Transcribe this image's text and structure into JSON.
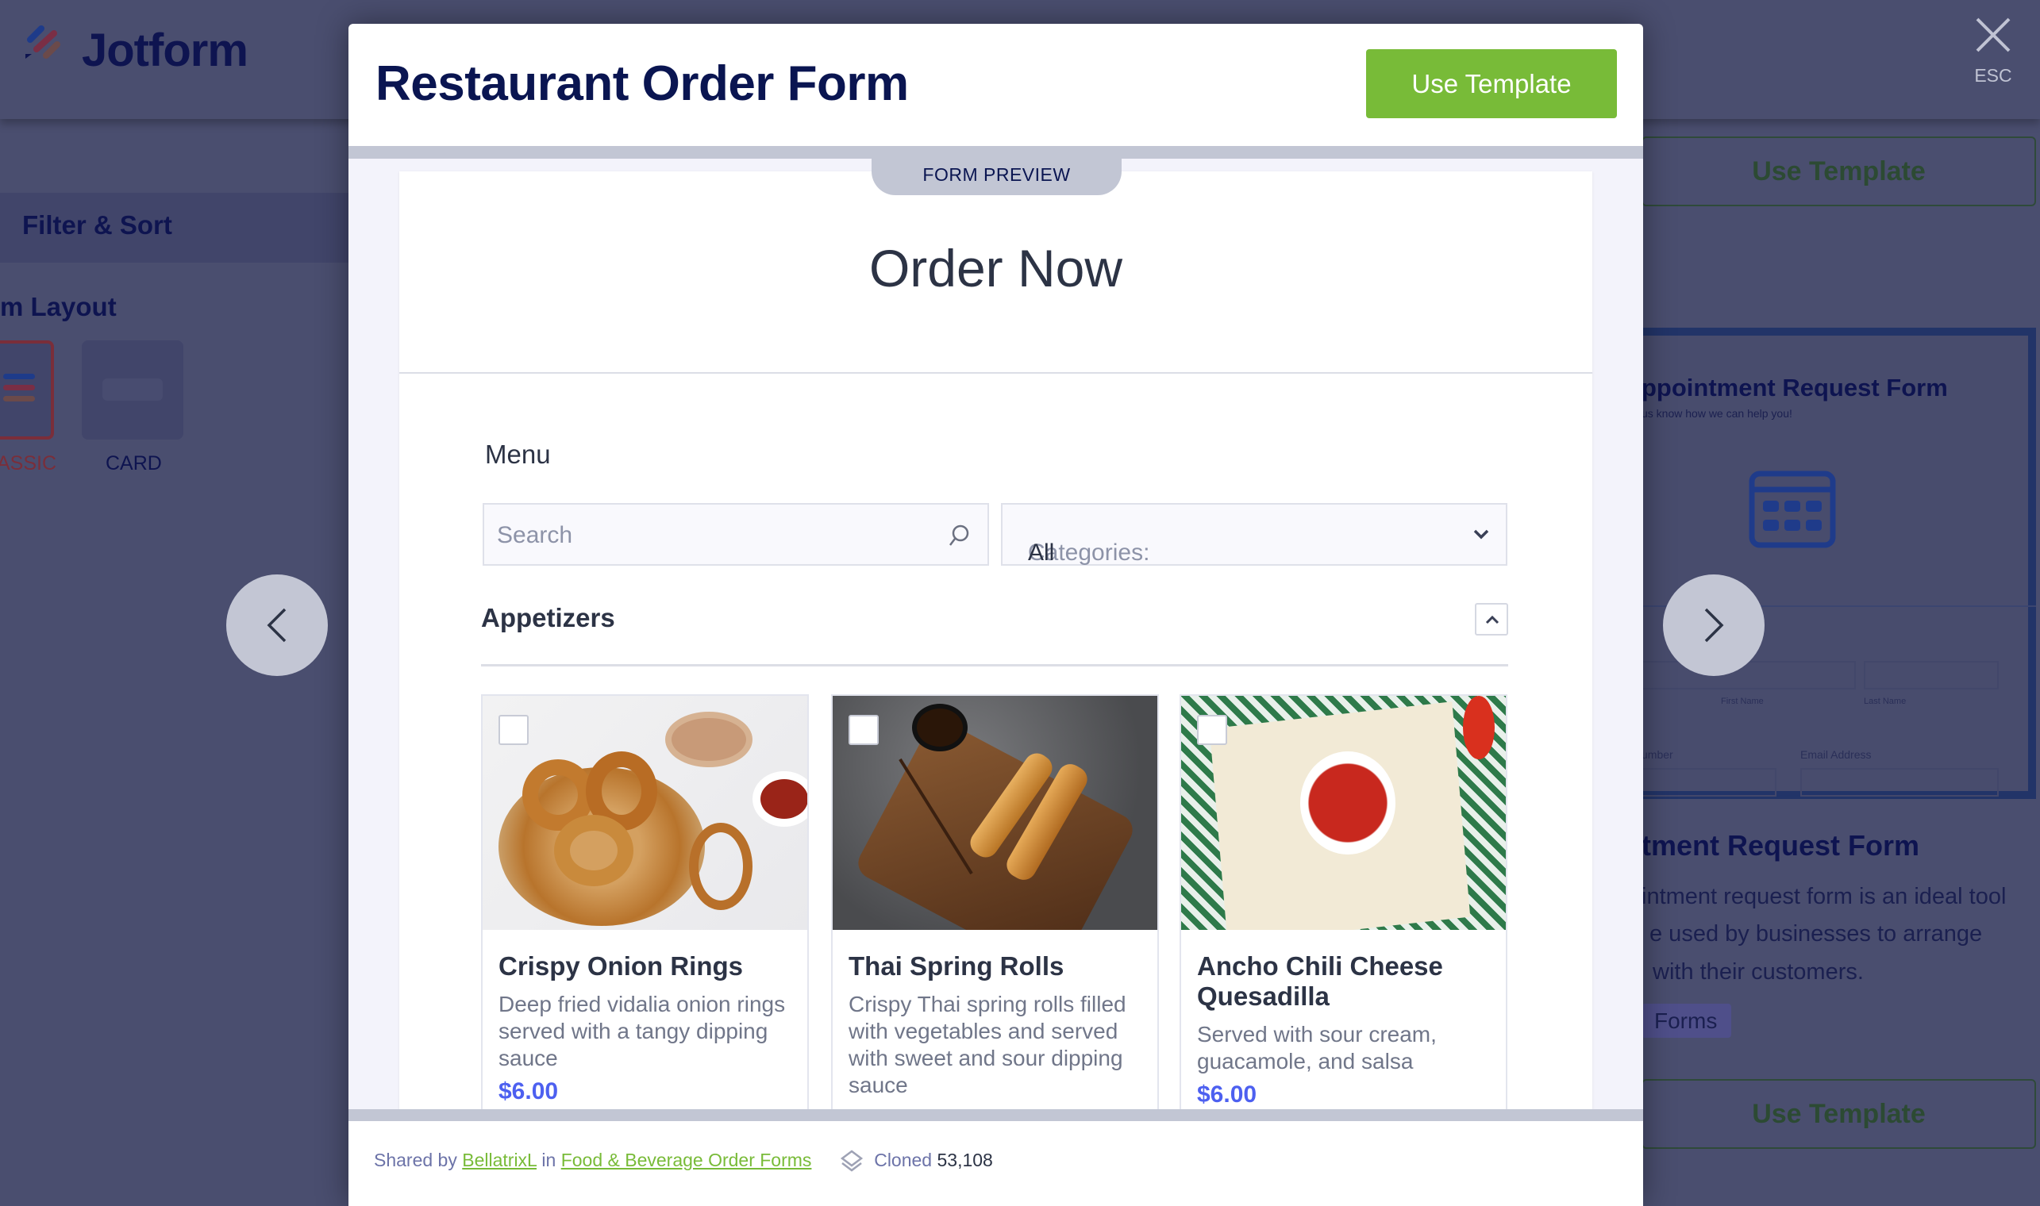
{
  "background": {
    "logo": "Jotform",
    "filter_sort": "Filter & Sort",
    "layout_heading": "m Layout",
    "layouts": [
      {
        "label": "ASSIC",
        "selected": true
      },
      {
        "label": "CARD",
        "selected": false
      }
    ],
    "use_template": "Use Template",
    "next_card": {
      "preview_title": "ppointment Request Form",
      "preview_subtitle": "us know how we can help you!",
      "field_labels": [
        "First Name",
        "Last Name",
        "umber",
        "Email Address"
      ],
      "title": "tment Request Form",
      "description_lines": [
        "intment request form is an ideal tool",
        "e used by businesses to arrange",
        "with their customers."
      ],
      "category_badge": "Forms"
    },
    "close_label": "ESC"
  },
  "modal": {
    "title": "Restaurant Order Form",
    "use_template": "Use Template",
    "preview_tab": "FORM PREVIEW",
    "accent_color": "#78bb38",
    "form": {
      "heading": "Order Now",
      "menu_label": "Menu",
      "search_placeholder": "Search",
      "categories_label": "Categories:",
      "categories_value": "All",
      "section": "Appetizers",
      "items": [
        {
          "title": "Crispy Onion Rings",
          "description": "Deep fried vidalia onion rings served with a tangy dipping sauce",
          "price": "$6.00",
          "checked": false
        },
        {
          "title": "Thai Spring Rolls",
          "description": "Crispy Thai spring rolls filled with vegetables and served with sweet and sour dipping sauce",
          "price": "",
          "checked": false
        },
        {
          "title": "Ancho Chili Cheese Quesadilla",
          "description": "Served with sour cream, guacamole, and salsa",
          "price": "$6.00",
          "checked": false
        }
      ]
    },
    "footer": {
      "shared_by": "Shared by",
      "author": "BellatrixL",
      "in": "in",
      "category": "Food & Beverage Order Forms",
      "cloned_label": "Cloned",
      "cloned_count": "53,108"
    }
  }
}
